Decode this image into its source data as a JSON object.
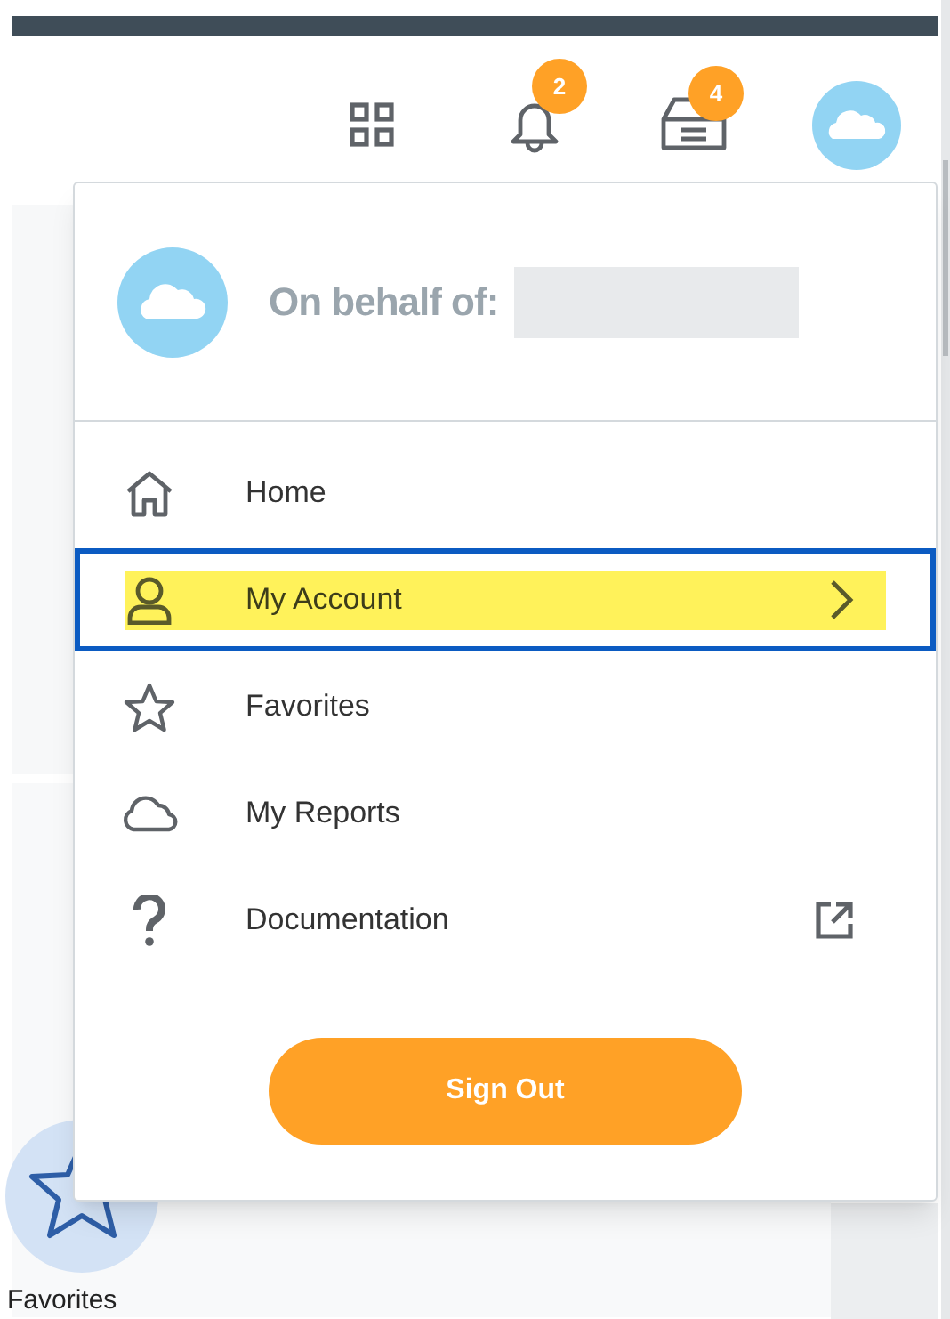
{
  "header": {
    "icons": [
      {
        "kind": "apps"
      },
      {
        "kind": "bell",
        "badge": "2"
      },
      {
        "kind": "inbox",
        "badge": "4"
      },
      {
        "kind": "avatar"
      }
    ]
  },
  "menu": {
    "behalf_label": "On behalf of:",
    "items": [
      {
        "kind": "link",
        "label": "Home",
        "selected": false
      },
      {
        "kind": "submenu",
        "label": "My Account",
        "selected": true
      },
      {
        "kind": "link",
        "label": "Favorites",
        "selected": false
      },
      {
        "kind": "link",
        "label": "My Reports",
        "selected": false
      },
      {
        "kind": "external",
        "label": "Documentation",
        "selected": false
      }
    ],
    "sign_out": "Sign Out"
  },
  "background": {
    "tile_label": "Favorites"
  }
}
